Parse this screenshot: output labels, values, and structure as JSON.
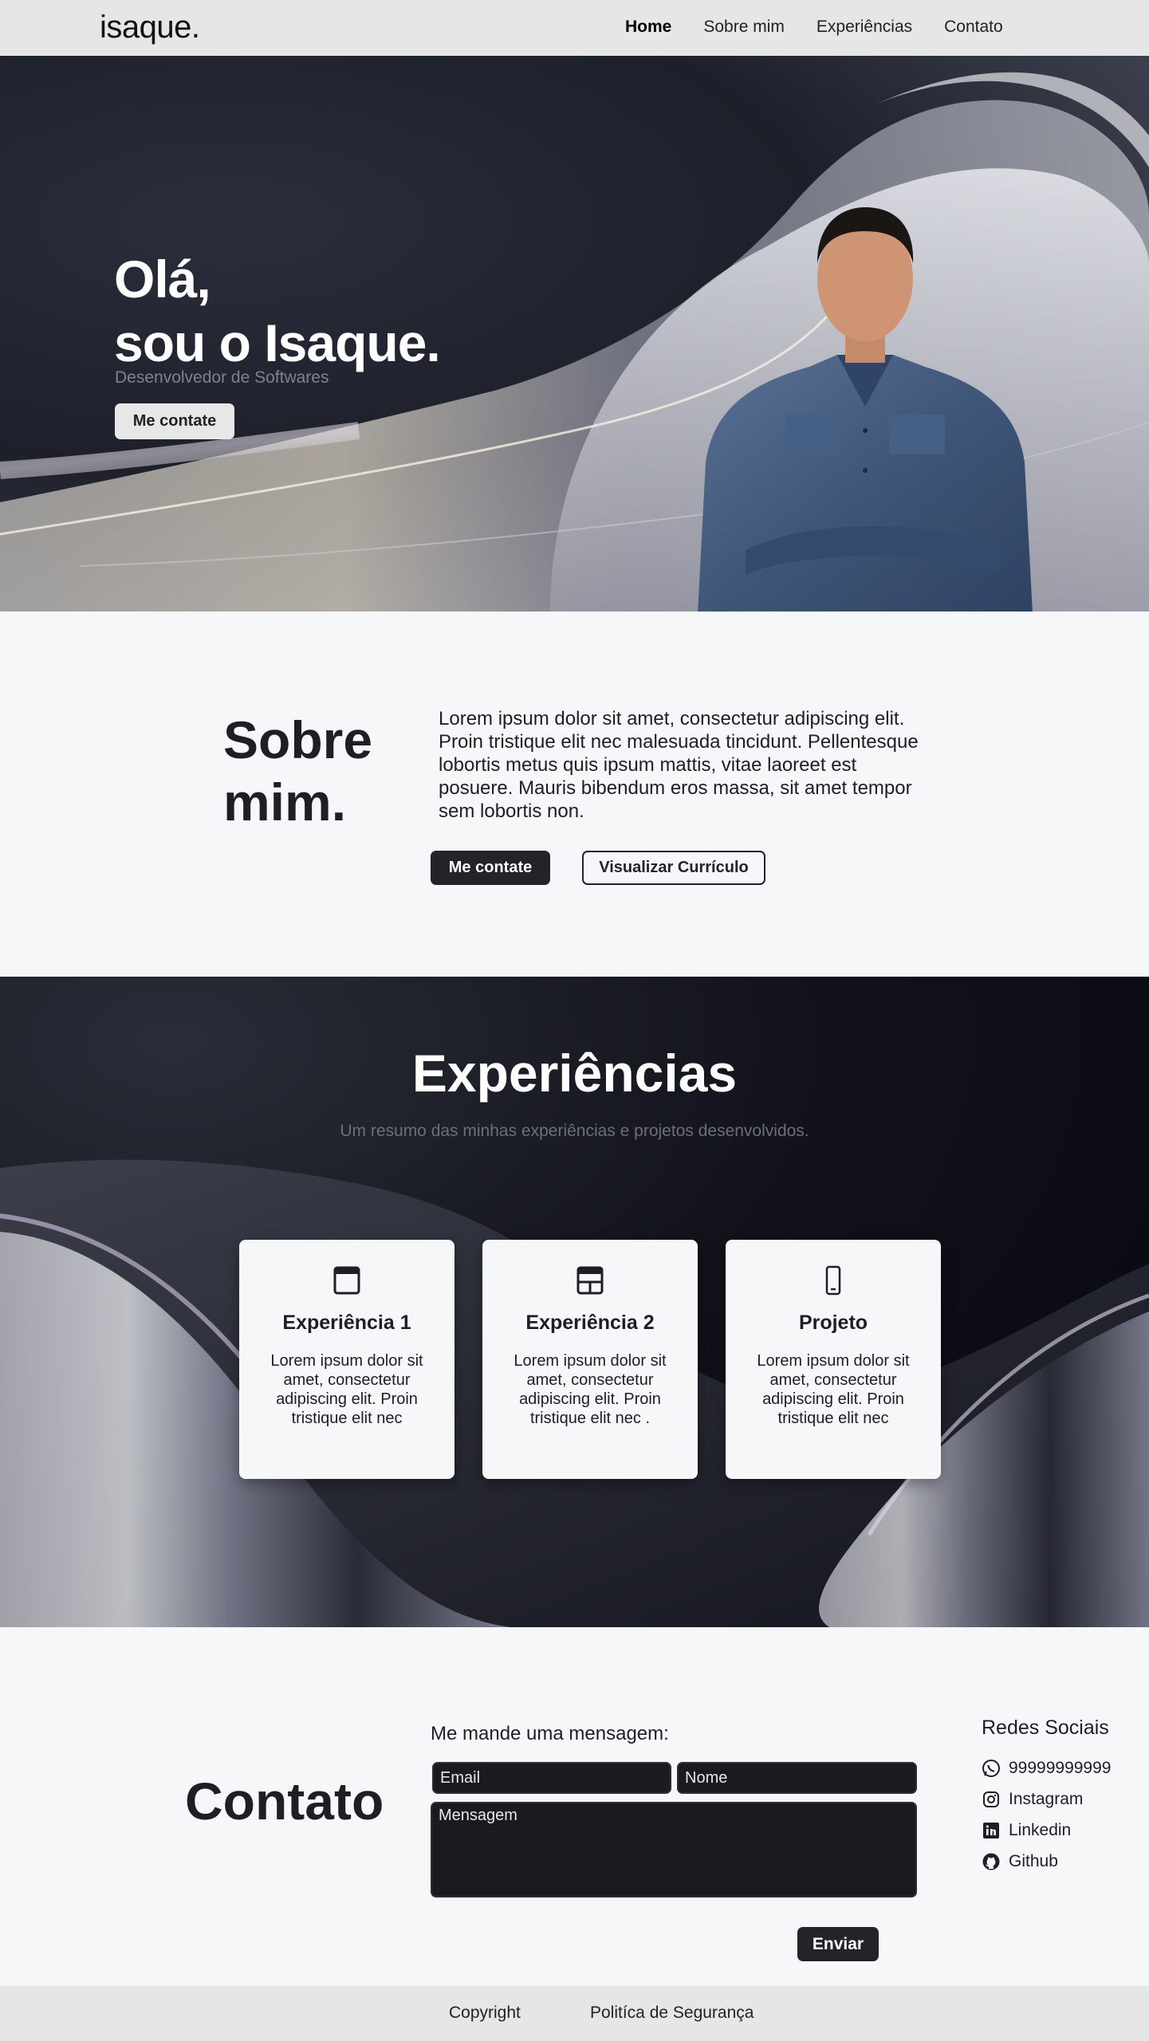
{
  "nav": {
    "logo": "isaque.",
    "links": [
      "Home",
      "Sobre mim",
      "Experiências",
      "Contato"
    ]
  },
  "hero": {
    "greeting": "Olá,",
    "name_line": "sou o Isaque.",
    "subtitle": "Desenvolvedor de Softwares",
    "cta": "Me contate"
  },
  "sobre": {
    "title_line1": "Sobre",
    "title_line2": "mim.",
    "text": "Lorem ipsum dolor sit amet, consectetur adipiscing elit. Proin tristique elit nec malesuada tincidunt. Pellentesque lobortis metus quis ipsum mattis, vitae laoreet est posuere. Mauris bibendum eros massa, sit amet tempor sem lobortis non.",
    "btn_contact": "Me contate",
    "btn_cv": "Visualizar Currículo"
  },
  "experiencias": {
    "title": "Experiências",
    "subtitle": "Um resumo das minhas experiências e projetos desenvolvidos.",
    "cards": [
      {
        "icon": "browser-window-icon",
        "title": "Experiência 1",
        "text": "Lorem ipsum dolor sit amet, consectetur adipiscing elit. Proin tristique elit nec"
      },
      {
        "icon": "web-layout-icon",
        "title": "Experiência 2",
        "text": "Lorem ipsum dolor sit amet, consectetur adipiscing elit. Proin tristique elit nec ."
      },
      {
        "icon": "smartphone-icon",
        "title": "Projeto",
        "text": "Lorem ipsum dolor sit amet, consectetur adipiscing elit. Proin tristique elit nec"
      }
    ]
  },
  "contato": {
    "title": "Contato",
    "form_label": "Me mande uma mensagem:",
    "email_placeholder": "Email",
    "nome_placeholder": "Nome",
    "mensagem_placeholder": "Mensagem",
    "send": "Enviar",
    "social_title": "Redes Sociais",
    "social": [
      {
        "icon": "whatsapp-icon",
        "label": "99999999999"
      },
      {
        "icon": "instagram-icon",
        "label": "Instagram"
      },
      {
        "icon": "linkedin-icon",
        "label": "Linkedin"
      },
      {
        "icon": "github-icon",
        "label": "Github"
      }
    ]
  },
  "footer": {
    "copyright": "Copyright",
    "policy": "Politíca de Segurança"
  },
  "colors": {
    "dark": "#232428",
    "light_bg": "#f6f7f9",
    "nav_bg": "#e6e6e6",
    "field_bg": "#191b20"
  }
}
